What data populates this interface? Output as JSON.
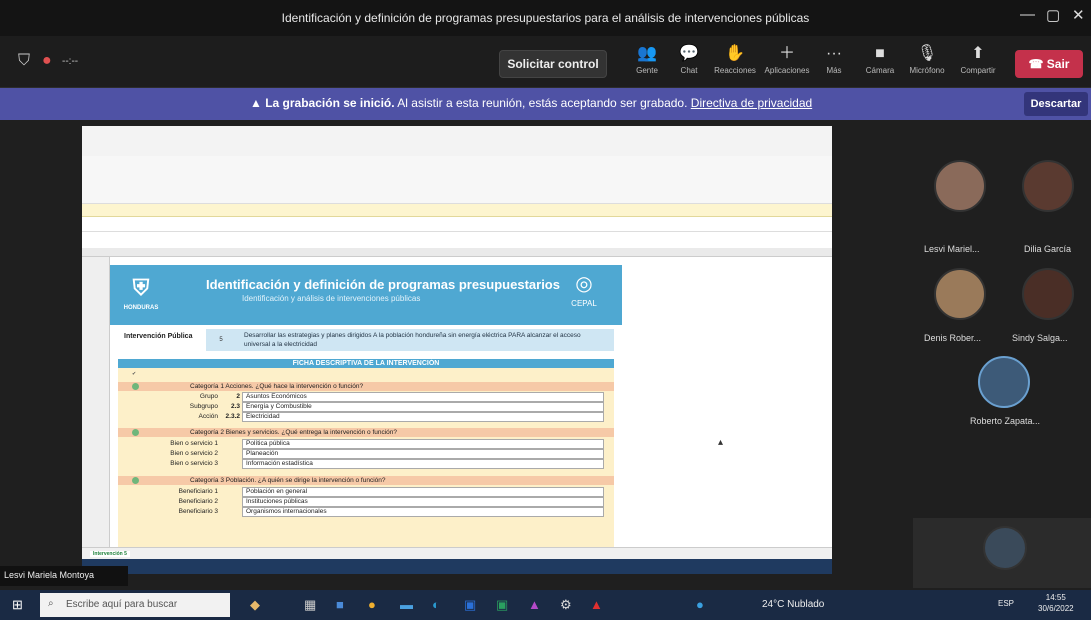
{
  "window": {
    "title": "Identificación y definición de programas presupuestarios para el análisis de intervenciones públicas",
    "minimize_icon": "—",
    "restore_icon": "▢",
    "close_icon": "✕"
  },
  "toolbar": {
    "request_control": "Solicitar control",
    "items": [
      {
        "label": "Gente",
        "icon": "people-icon"
      },
      {
        "label": "Chat",
        "icon": "chat-icon"
      },
      {
        "label": "Reacciones",
        "icon": "reactions-icon"
      },
      {
        "label": "Aplicaciones",
        "icon": "apps-icon"
      },
      {
        "label": "Más",
        "icon": "more-icon"
      },
      {
        "label": "Cámara",
        "icon": "camera-icon"
      },
      {
        "label": "Micrófono",
        "icon": "mic-icon"
      },
      {
        "label": "Compartir",
        "icon": "share-icon"
      }
    ],
    "leave": "Sair",
    "leave_color": "#c4314b"
  },
  "banner": {
    "bold": "La grabación se inició.",
    "text": " Al asistir a esta reunión, estás aceptando ser grabado. ",
    "link": "Directiva de privacidad",
    "dismiss": "Descartar",
    "color": "#4f52a5"
  },
  "sheet": {
    "header_title": "Identificación y definición de programas presupuestarios",
    "header_subtitle": "Identificación y análisis de intervenciones públicas",
    "honduras": "HONDURAS",
    "cepal": "CEPAL",
    "intervention_label": "Intervención Pública",
    "intervention_num": "5",
    "intervention_text": "Desarrollar las estrategias y planes dirigidos A la población hondureña sin energía eléctrica PARA alcanzar el acceso universal a la electricidad",
    "fd_head": "FICHA DESCRIPTIVA DE LA INTERVENCIÓN",
    "cat1": "Categoría 1 Acciones. ¿Qué hace la intervención o función?",
    "cat1_rows": [
      {
        "label": "Grupo",
        "num": "2",
        "value": "Asuntos Económicos"
      },
      {
        "label": "Subgrupo",
        "num": "2.3",
        "value": "Energía y Combustible"
      },
      {
        "label": "Acción",
        "num": "2.3.2",
        "value": "Electricidad"
      }
    ],
    "cat2": "Categoría 2 Bienes y servicios. ¿Qué entrega la intervención o función?",
    "cat2_rows": [
      {
        "label": "Bien o servicio 1",
        "value": "Política pública"
      },
      {
        "label": "Bien o servicio 2",
        "value": "Planeación"
      },
      {
        "label": "Bien o servicio 3",
        "value": "Información estadística"
      }
    ],
    "cat3": "Categoría 3 Población. ¿A quién se dirige la intervención o función?",
    "cat3_rows": [
      {
        "label": "Beneficiario 1",
        "value": "Población en general"
      },
      {
        "label": "Beneficiario 2",
        "value": "Instituciones públicas"
      },
      {
        "label": "Beneficiario 3",
        "value": "Organismos internacionales"
      }
    ],
    "active_tab": "Intervención 5"
  },
  "participants": [
    {
      "name": "Lesvi Mariel..."
    },
    {
      "name": "Dilia García"
    },
    {
      "name": "Denis Rober..."
    },
    {
      "name": "Sindy Salga..."
    },
    {
      "name": "Roberto Zapata..."
    }
  ],
  "self_name": "Lesvi Mariela Montoya",
  "taskbar": {
    "search_placeholder": "Escribe aquí para buscar",
    "weather": "24°C Nublado",
    "lang": "ESP",
    "time": "14:55",
    "date": "30/6/2022"
  }
}
